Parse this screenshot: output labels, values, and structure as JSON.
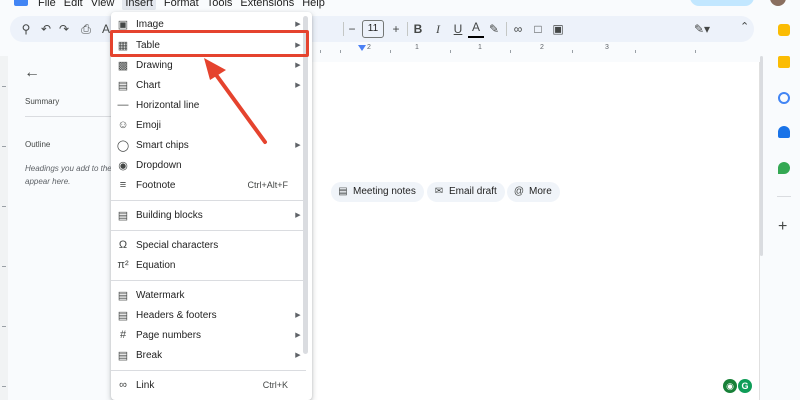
{
  "menubar": {
    "items": [
      "File",
      "Edit",
      "View",
      "Insert",
      "Format",
      "Tools",
      "Extensions",
      "Help"
    ],
    "active_index": 3
  },
  "toolbar": {
    "font_size": "11"
  },
  "ruler": {
    "labels": [
      "2",
      "1",
      "1",
      "2",
      "3"
    ]
  },
  "outline_panel": {
    "summary_label": "Summary",
    "outline_label": "Outline",
    "hint_line1": "Headings you add to the",
    "hint_line2": "appear here."
  },
  "insert_menu": {
    "items": [
      {
        "icon": "image-icon",
        "label": "Image",
        "has_submenu": true
      },
      {
        "icon": "table-icon",
        "label": "Table",
        "has_submenu": true
      },
      {
        "icon": "drawing-icon",
        "label": "Drawing",
        "has_submenu": true
      },
      {
        "icon": "chart-icon",
        "label": "Chart",
        "has_submenu": true
      },
      {
        "icon": "horizontal-line-icon",
        "label": "Horizontal line",
        "has_submenu": false
      },
      {
        "icon": "emoji-icon",
        "label": "Emoji",
        "has_submenu": false
      },
      {
        "icon": "smart-chips-icon",
        "label": "Smart chips",
        "has_submenu": true
      },
      {
        "icon": "dropdown-icon",
        "label": "Dropdown",
        "has_submenu": false
      },
      {
        "icon": "footnote-icon",
        "label": "Footnote",
        "shortcut": "Ctrl+Alt+F"
      },
      {
        "icon": "building-blocks-icon",
        "label": "Building blocks",
        "has_submenu": true
      },
      {
        "icon": "special-characters-icon",
        "label": "Special characters",
        "has_submenu": false
      },
      {
        "icon": "equation-icon",
        "label": "Equation",
        "has_submenu": false
      },
      {
        "icon": "watermark-icon",
        "label": "Watermark",
        "has_submenu": false
      },
      {
        "icon": "headers-footers-icon",
        "label": "Headers & footers",
        "has_submenu": true
      },
      {
        "icon": "page-numbers-icon",
        "label": "Page numbers",
        "has_submenu": true
      },
      {
        "icon": "break-icon",
        "label": "Break",
        "has_submenu": true
      },
      {
        "icon": "link-icon",
        "label": "Link",
        "shortcut": "Ctrl+K"
      }
    ]
  },
  "chips": {
    "meeting_notes": "Meeting notes",
    "email_draft": "Email draft",
    "more": "More"
  },
  "colors": {
    "highlight": "#e5432e",
    "brand": "#4285f4"
  }
}
